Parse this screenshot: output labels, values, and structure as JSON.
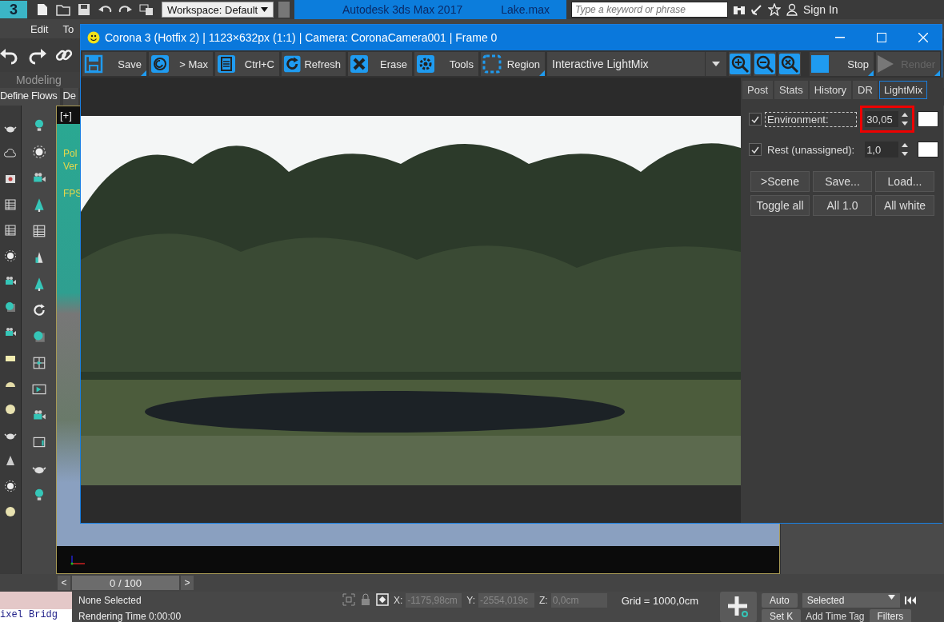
{
  "app_bar": {
    "logo": "3",
    "workspace": "Workspace: Default",
    "title": "Autodesk 3ds Max 2017",
    "file": "Lake.max",
    "search": {
      "placeholder": "Type a keyword or phrase"
    },
    "sign_in": "Sign In"
  },
  "menu": [
    "Edit",
    "To"
  ],
  "ribbon": {
    "tab": "Modeling",
    "flows": [
      "Define Flows",
      "De"
    ]
  },
  "viewport": {
    "label": "[+]",
    "stats": [
      "Pol",
      "Ver",
      "FPS"
    ]
  },
  "timeline": {
    "prev": "<",
    "position": "0 / 100",
    "next": ">"
  },
  "status_bar": {
    "script_tag": "ixel Bridg",
    "selection": "None Selected",
    "render_time": "Rendering Time  0:00:00",
    "x_label": "X:",
    "x_value": "-1175,98cm",
    "y_label": "Y:",
    "y_value": "-2554,019c",
    "z_label": "Z:",
    "z_value": "0,0cm",
    "grid": "Grid = 1000,0cm",
    "auto": "Auto",
    "set_key": "Set K",
    "key_filter": "Selected",
    "filters": "Filters",
    "time_tag": "Add Time Tag"
  },
  "corona": {
    "title": "Corona 3 (Hotfix 2) | 1123×632px (1:1) | Camera: CoronaCamera001 | Frame 0",
    "toolbar": [
      {
        "kind": "save",
        "label": "Save",
        "menu": true
      },
      {
        "kind": "max",
        "label": "> Max",
        "menu": false
      },
      {
        "kind": "copy",
        "label": "Ctrl+C",
        "menu": false
      },
      {
        "kind": "refresh",
        "label": "Refresh",
        "menu": false
      },
      {
        "kind": "erase",
        "label": "Erase",
        "menu": false
      },
      {
        "kind": "tools",
        "label": "Tools",
        "menu": false
      },
      {
        "kind": "region",
        "label": "Region",
        "menu": true
      }
    ],
    "view_select": "Interactive LightMix",
    "stop": {
      "label": "Stop",
      "disabled": false
    },
    "render": {
      "label": "Render",
      "disabled": true
    },
    "tabs": [
      {
        "label": "Post",
        "selected": false
      },
      {
        "label": "Stats",
        "selected": false
      },
      {
        "label": "History",
        "selected": false
      },
      {
        "label": "DR",
        "selected": false
      },
      {
        "label": "LightMix",
        "selected": true
      }
    ],
    "lightmix": [
      {
        "label": "Environment:",
        "checked": true,
        "focused": true,
        "value": "30,05",
        "color": "#ffffff",
        "highlighted": true
      },
      {
        "label": "Rest (unassigned):",
        "checked": true,
        "focused": false,
        "value": "1,0",
        "color": "#ffffff",
        "highlighted": false
      }
    ],
    "buttons": [
      ">Scene",
      "Save...",
      "Load...",
      "Toggle all",
      "All 1.0",
      "All white"
    ]
  }
}
